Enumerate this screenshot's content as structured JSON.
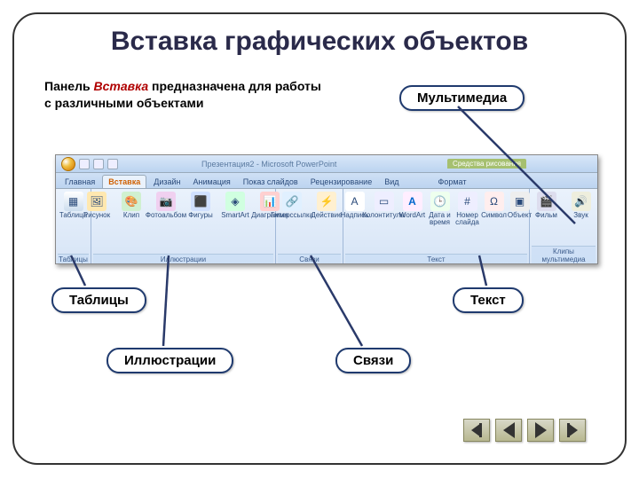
{
  "title": "Вставка графических объектов",
  "subtitle_pre": "Панель ",
  "subtitle_hl": "Вставка",
  "subtitle_post": " предназначена для работы с различными объектами",
  "callouts": {
    "multimedia": "Мультимедиа",
    "tables": "Таблицы",
    "text": "Текст",
    "illustrations": "Иллюстрации",
    "links": "Связи"
  },
  "ribbon": {
    "doc_title": "Презентация2 - Microsoft PowerPoint",
    "context_title": "Средства рисования",
    "tabs": [
      "Главная",
      "Вставка",
      "Дизайн",
      "Анимация",
      "Показ слайдов",
      "Рецензирование",
      "Вид",
      "Формат"
    ],
    "active_tab": "Вставка",
    "groups": {
      "tables": {
        "name": "Таблицы",
        "items": [
          "Таблица"
        ]
      },
      "illustrations": {
        "name": "Иллюстрации",
        "items": [
          "Рисунок",
          "Клип",
          "Фотоальбом",
          "Фигуры",
          "SmartArt",
          "Диаграмма"
        ]
      },
      "links": {
        "name": "Связи",
        "items": [
          "Гиперссылка",
          "Действие"
        ]
      },
      "text": {
        "name": "Текст",
        "items": [
          "Надпись",
          "Колонтитулы",
          "WordArt",
          "Дата и\nвремя",
          "Номер\nслайда",
          "Символ",
          "Объект"
        ]
      },
      "media": {
        "name": "Клипы мультимедиа",
        "items": [
          "Фильм",
          "Звук"
        ]
      }
    }
  }
}
